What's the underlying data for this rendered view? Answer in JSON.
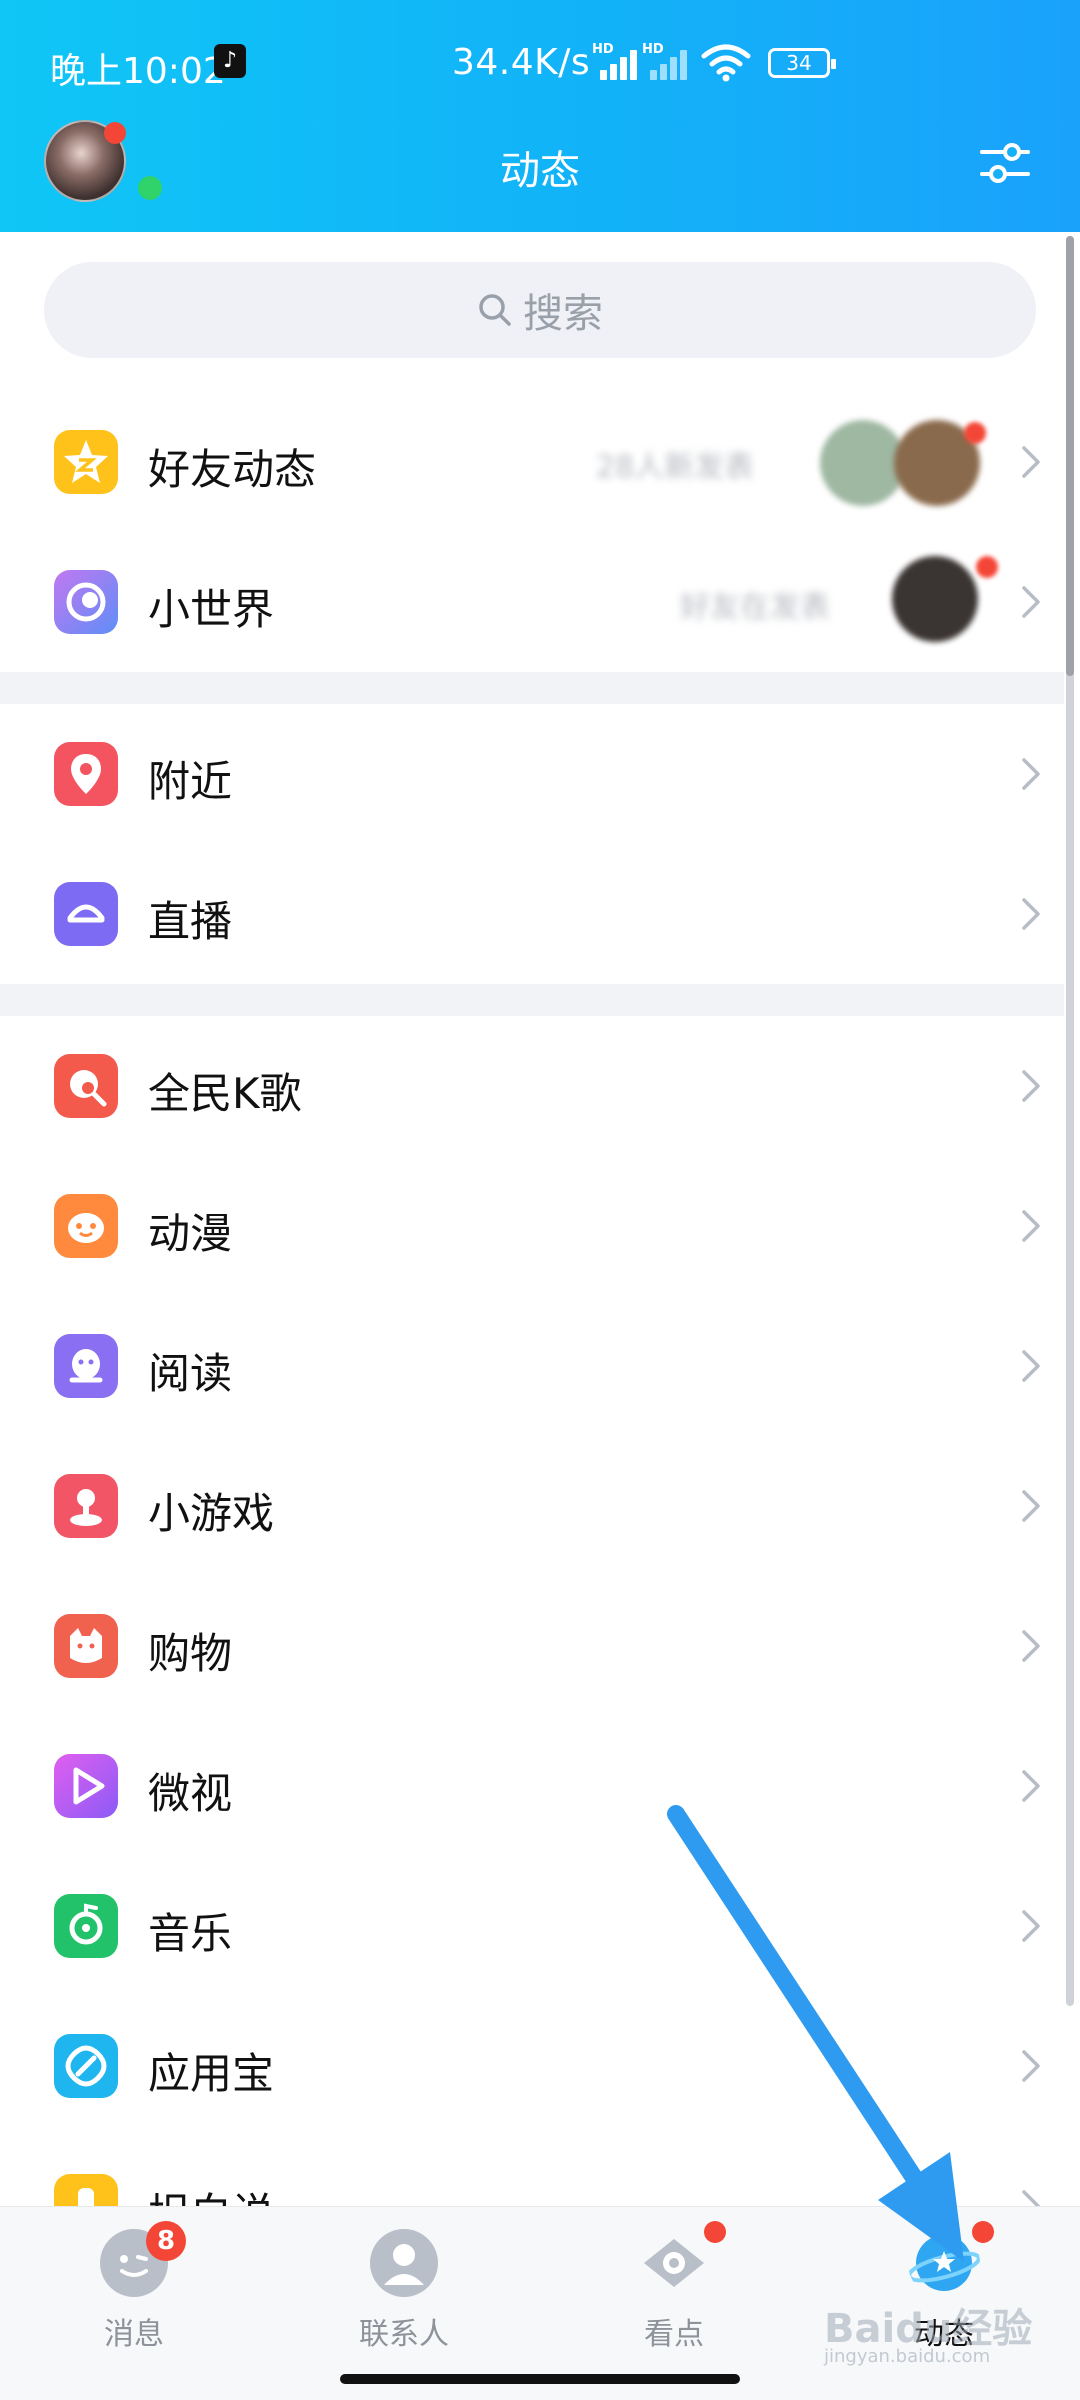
{
  "status_bar": {
    "time": "晚上10:02",
    "net_speed": "34.4K/s",
    "hd_label": "HD",
    "battery": "34"
  },
  "header": {
    "title": "动态"
  },
  "search": {
    "placeholder": "搜索"
  },
  "sections": [
    {
      "items": [
        {
          "label": "好友动态",
          "icon": "qzone-star-icon",
          "color": "#ffc21a",
          "right_text": "28人新发表"
        },
        {
          "label": "小世界",
          "icon": "small-world-icon",
          "color": "#6e7cf5",
          "right_text": "好友在发表"
        }
      ]
    },
    {
      "items": [
        {
          "label": "附近",
          "icon": "location-pin-icon",
          "color": "#f3545f"
        },
        {
          "label": "直播",
          "icon": "live-icon",
          "color": "#7d6cf3"
        }
      ]
    },
    {
      "items": [
        {
          "label": "全民K歌",
          "icon": "karaoke-icon",
          "color": "#f45a4c"
        },
        {
          "label": "动漫",
          "icon": "anime-icon",
          "color": "#ff8a3d"
        },
        {
          "label": "阅读",
          "icon": "reading-icon",
          "color": "#8a6ff3"
        },
        {
          "label": "小游戏",
          "icon": "mini-game-icon",
          "color": "#f25566"
        },
        {
          "label": "购物",
          "icon": "shopping-icon",
          "color": "#f0614e"
        },
        {
          "label": "微视",
          "icon": "weishi-icon",
          "color": "#b05cf0"
        },
        {
          "label": "音乐",
          "icon": "music-icon",
          "color": "#22c26a"
        },
        {
          "label": "应用宝",
          "icon": "app-store-icon",
          "color": "#1fb6f0"
        },
        {
          "label": "坦白说",
          "icon": "confession-icon",
          "color": "#ffc21a"
        }
      ]
    }
  ],
  "bottom_nav": [
    {
      "label": "消息",
      "icon": "message-icon",
      "badge": "8"
    },
    {
      "label": "联系人",
      "icon": "contacts-icon"
    },
    {
      "label": "看点",
      "icon": "eye-icon"
    },
    {
      "label": "动态",
      "icon": "planet-icon",
      "active": true
    }
  ],
  "watermark": {
    "text": "Baidu经验",
    "sub": "jingyan.baidu.com"
  }
}
